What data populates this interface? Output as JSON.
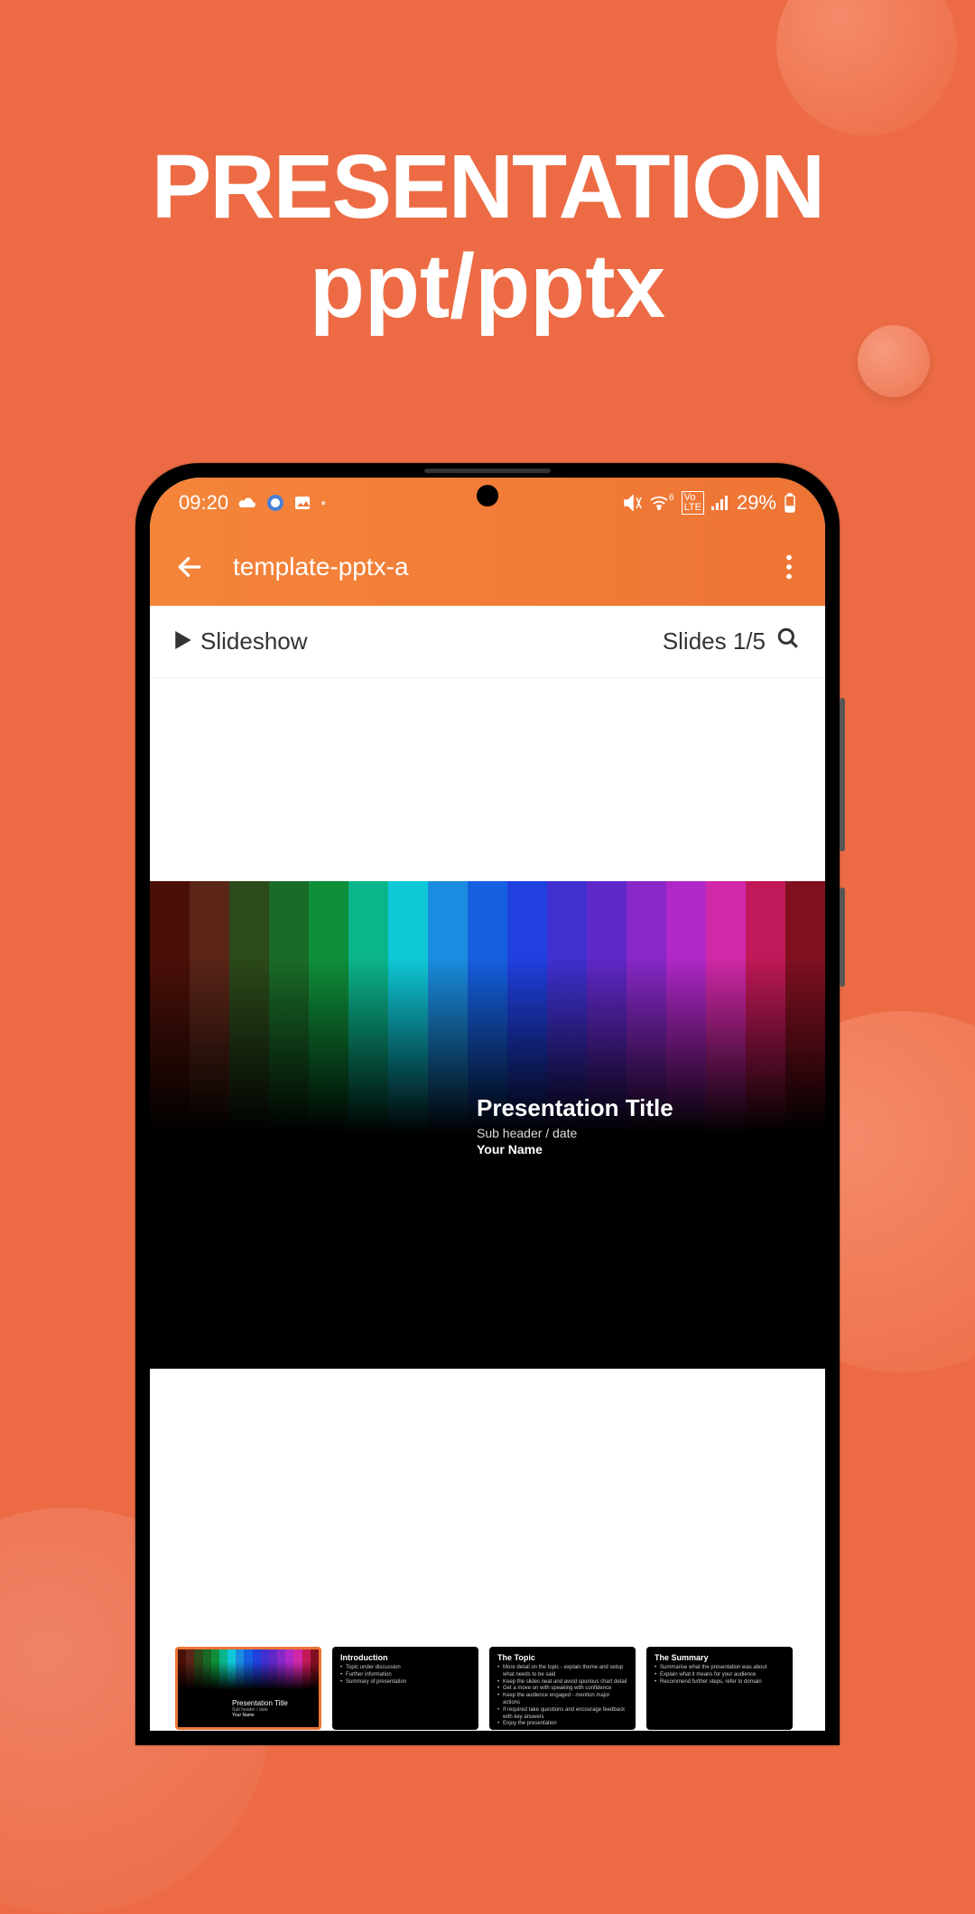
{
  "promo": {
    "line1": "PRESENTATION",
    "line2": "ppt/pptx"
  },
  "statusbar": {
    "time": "09:20",
    "battery": "29%"
  },
  "appbar": {
    "title": "template-pptx-a"
  },
  "toolbar": {
    "slideshow_label": "Slideshow",
    "slides_label": "Slides 1/5"
  },
  "main_slide": {
    "title": "Presentation Title",
    "subheader": "Sub header / date",
    "author": "Your Name"
  },
  "thumbs": [
    {
      "type": "title",
      "title": "Presentation Title",
      "sub": "Sub header / date",
      "author": "Your Name",
      "active": true
    },
    {
      "type": "content",
      "heading": "Introduction",
      "bullets": [
        "Topic under discussion",
        "Further information",
        "Summary of presentation"
      ]
    },
    {
      "type": "content",
      "heading": "The Topic",
      "bullets": [
        "More detail on the topic - explain theme and setup what needs to be said",
        "Keep the slides neat and avoid spurious chart detail",
        "Get a move on with speaking with confidence",
        "Keep the audience engaged - mention major actions",
        "If required take questions and encourage feedback with key answers",
        "Enjoy the presentation"
      ]
    },
    {
      "type": "content",
      "heading": "The Summary",
      "bullets": [
        "Summarise what the presentation was about",
        "Explain what it means for your audience",
        "Recommend further steps, refer to domain"
      ]
    }
  ],
  "spectrum_colors": [
    "#4a1008",
    "#5b2518",
    "#2c4a1a",
    "#1a6b28",
    "#0f8f3a",
    "#0bb58c",
    "#0fc9d9",
    "#1a8de0",
    "#1560e0",
    "#2040e0",
    "#4030d0",
    "#6028c8",
    "#8828c8",
    "#b028c8",
    "#d028a8",
    "#c01858",
    "#801020"
  ]
}
